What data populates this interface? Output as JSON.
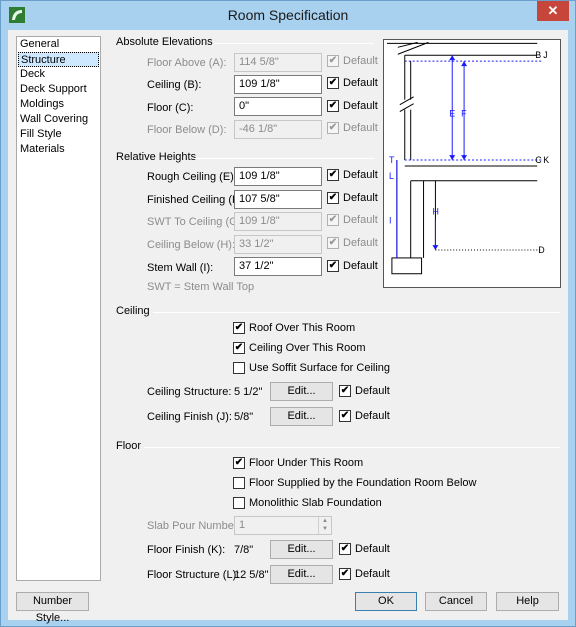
{
  "window": {
    "title": "Room Specification"
  },
  "nav": {
    "items": [
      "General",
      "Structure",
      "Deck",
      "Deck Support",
      "Moldings",
      "Wall Covering",
      "Fill Style",
      "Materials"
    ],
    "selected": "Structure"
  },
  "absolute": {
    "heading": "Absolute Elevations",
    "floor_above": {
      "label": "Floor Above (A):",
      "value": "114 5/8\"",
      "default_label": "Default"
    },
    "ceiling": {
      "label": "Ceiling (B):",
      "value": "109 1/8\"",
      "default_label": "Default"
    },
    "floor": {
      "label": "Floor (C):",
      "value": "0\"",
      "default_label": "Default"
    },
    "floor_below": {
      "label": "Floor Below (D):",
      "value": "-46 1/8\"",
      "default_label": "Default"
    }
  },
  "relative": {
    "heading": "Relative Heights",
    "rough_ceiling": {
      "label": "Rough Ceiling (E):",
      "value": "109 1/8\"",
      "default_label": "Default"
    },
    "finished_ceiling": {
      "label": "Finished Ceiling (F):",
      "value": "107 5/8\"",
      "default_label": "Default"
    },
    "swt_to_ceiling": {
      "label": "SWT To Ceiling (G):",
      "value": "109 1/8\"",
      "default_label": "Default"
    },
    "ceiling_below": {
      "label": "Ceiling Below (H):",
      "value": "33 1/2\"",
      "default_label": "Default"
    },
    "stem_wall": {
      "label": "Stem Wall (I):",
      "value": "37 1/2\"",
      "default_label": "Default"
    },
    "note": "SWT = Stem Wall Top"
  },
  "diagram": {
    "labels": {
      "b_j": "B",
      "j": "J",
      "e": "E",
      "f": "F",
      "c_k": "C",
      "k": "K",
      "t": "T",
      "l": "L",
      "i": "I",
      "h": "H",
      "d": "D"
    }
  },
  "ceiling": {
    "heading": "Ceiling",
    "roof_over": "Roof Over This Room",
    "ceiling_over": "Ceiling Over This Room",
    "soffit": "Use Soffit Surface for Ceiling",
    "structure": {
      "label": "Ceiling Structure:",
      "value": "5 1/2\"",
      "edit": "Edit...",
      "default_label": "Default"
    },
    "finish": {
      "label": "Ceiling Finish (J):",
      "value": "5/8\"",
      "edit": "Edit...",
      "default_label": "Default"
    }
  },
  "floor": {
    "heading": "Floor",
    "under": "Floor Under This Room",
    "supplied": "Floor Supplied by the Foundation Room Below",
    "monolithic": "Monolithic Slab Foundation",
    "slab_pour": {
      "label": "Slab Pour Number:",
      "value": "1"
    },
    "finish": {
      "label": "Floor Finish (K):",
      "value": "7/8\"",
      "edit": "Edit...",
      "default_label": "Default"
    },
    "structure": {
      "label": "Floor Structure (L):",
      "value": "12 5/8\"",
      "edit": "Edit...",
      "default_label": "Default"
    }
  },
  "footer": {
    "number_style": "Number Style...",
    "ok": "OK",
    "cancel": "Cancel",
    "help": "Help"
  },
  "check_glyph": "✔",
  "colors": {
    "titlebar": "#a8d0ef",
    "close": "#c7463b",
    "diagram_blue": "#1a1aff",
    "selected": "#cde8ff"
  }
}
